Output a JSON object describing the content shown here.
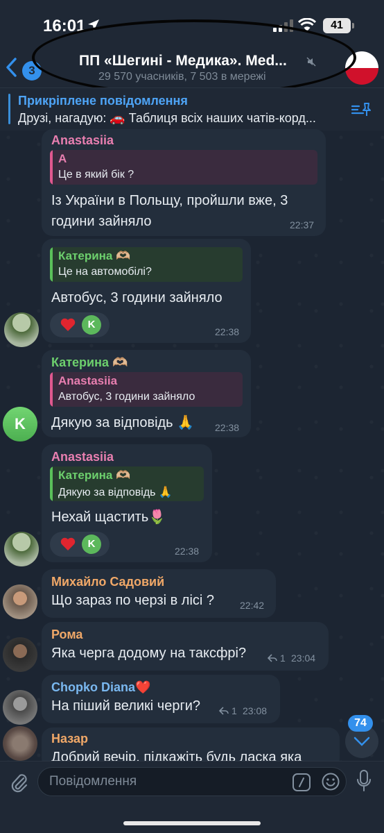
{
  "status_bar": {
    "time": "16:01",
    "battery": "41"
  },
  "header": {
    "back_badge": "3",
    "title": "ПП «Шегині - Медика». Med...",
    "subtitle": "29 570 учасників, 7 503 в мережі"
  },
  "pinned": {
    "title": "Прикріплене повідомлення",
    "text": "Друзі, нагадую: 🚗 Таблиця всіх наших чатів-корд..."
  },
  "messages": [
    {
      "sender": "Anastasiia",
      "sender_color": "#e87fb0",
      "quote": {
        "name": "A",
        "text": "Це в який бік ?",
        "color": "#e0588f"
      },
      "lines": [
        "Із України в Польщу, пройшли вже, 3",
        "години зайняло"
      ],
      "time": "22:37"
    },
    {
      "sender": "",
      "quote": {
        "name": "Катерина 🫶🏼",
        "text": "Це на автомобілі?",
        "color": "#5ac05a"
      },
      "lines": [
        "Автобус, 3 години зайняло"
      ],
      "reaction": {
        "emoji": "heart",
        "user": "K"
      },
      "time": "22:38"
    },
    {
      "sender": "Катерина 🫶🏼",
      "sender_color": "#6dd06d",
      "quote": {
        "name": "Anastasiia",
        "text": "Автобус, 3 години зайняло",
        "color": "#e0588f"
      },
      "lines": [
        "Дякую за відповідь 🙏"
      ],
      "avatar": "K",
      "time": "22:38"
    },
    {
      "sender": "Anastasiia",
      "sender_color": "#e87fb0",
      "quote": {
        "name": "Катерина 🫶🏼",
        "text": "Дякую за відповідь 🙏",
        "color": "#5ac05a"
      },
      "lines": [
        "Нехай щастить🌷"
      ],
      "reaction": {
        "emoji": "heart",
        "user": "K"
      },
      "time": "22:38"
    },
    {
      "sender": "Михайло Садовий",
      "sender_color": "#f0a868",
      "lines": [
        "Що  зараз по черзі в лісі ?"
      ],
      "time": "22:42"
    },
    {
      "sender": "Рома",
      "sender_color": "#f0a868",
      "lines": [
        "Яка черга додому на таксфрі?"
      ],
      "replies": "1",
      "time": "23:04"
    },
    {
      "sender": "Chopko Diana❤️",
      "sender_color": "#7ab8f0",
      "lines": [
        "На піший великі черги?"
      ],
      "replies": "1",
      "time": "23:08"
    },
    {
      "sender": "Назар",
      "sender_color": "#f0a868",
      "lines": [
        "Добрий вечір, підкажіть будь ласка яка"
      ]
    }
  ],
  "scroll": {
    "unread": "74"
  },
  "input": {
    "placeholder": "Повідомлення"
  },
  "colors": {
    "accent": "#3390ec",
    "bubble": "#232e3c",
    "background": "#1c2532"
  }
}
